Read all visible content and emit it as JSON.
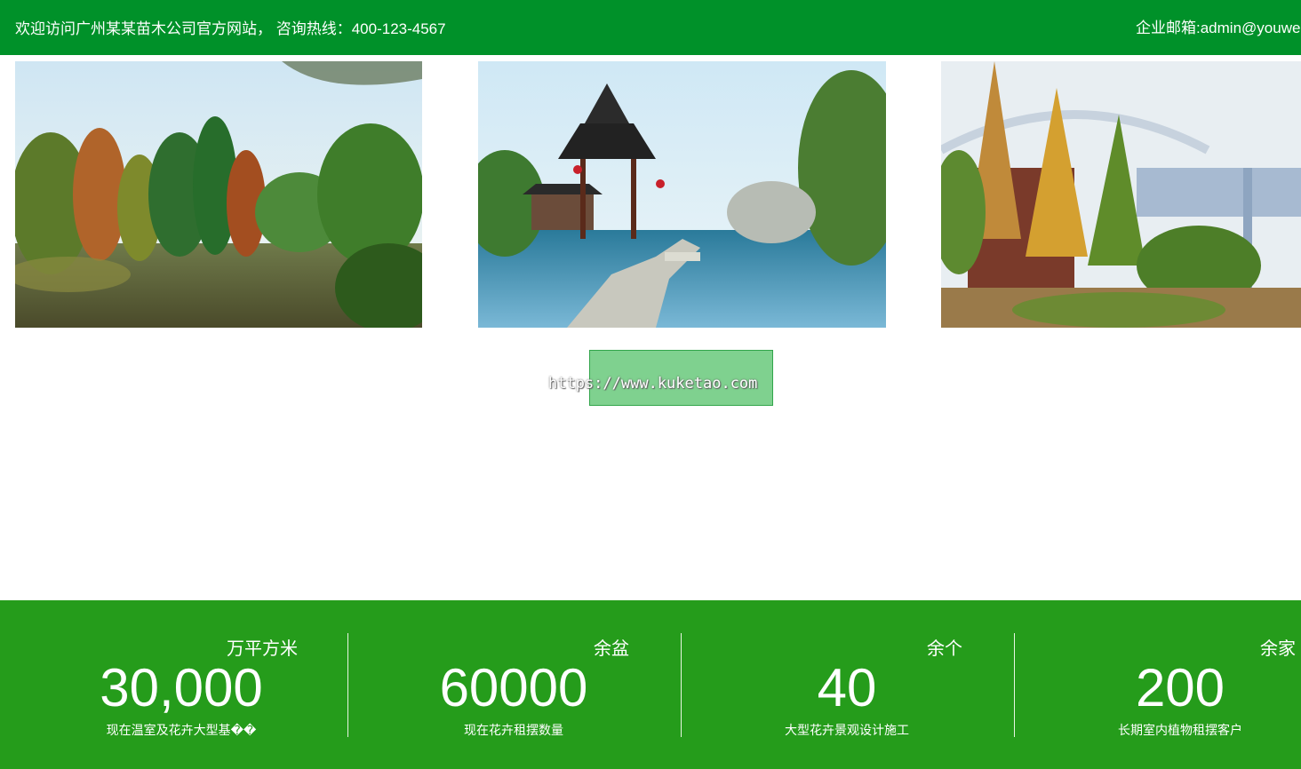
{
  "header": {
    "welcome_text": "欢迎访问广州某某苗木公司官方网站，  咨询热线：400-123-4567",
    "email_text": "企业邮箱:admin@youwe"
  },
  "gallery": {
    "images": [
      {
        "alt": "lake-with-autumn-trees-photo"
      },
      {
        "alt": "chinese-pavilion-garden-photo"
      },
      {
        "alt": "autumn-trees-near-bridge-photo"
      }
    ]
  },
  "watermark": {
    "text": "https://www.kuketao.com"
  },
  "stats": [
    {
      "unit": "万平方米",
      "value": "30,000",
      "desc": "现在温室及花卉大型基��"
    },
    {
      "unit": "余盆",
      "value": "60000",
      "desc": "现在花卉租摆数量"
    },
    {
      "unit": "余个",
      "value": "40",
      "desc": "大型花卉景观设计施工"
    },
    {
      "unit": "余家",
      "value": "200",
      "desc": "长期室内植物租摆客户"
    }
  ],
  "colors": {
    "header_bg": "#009129",
    "stats_bg": "#259c1b"
  }
}
